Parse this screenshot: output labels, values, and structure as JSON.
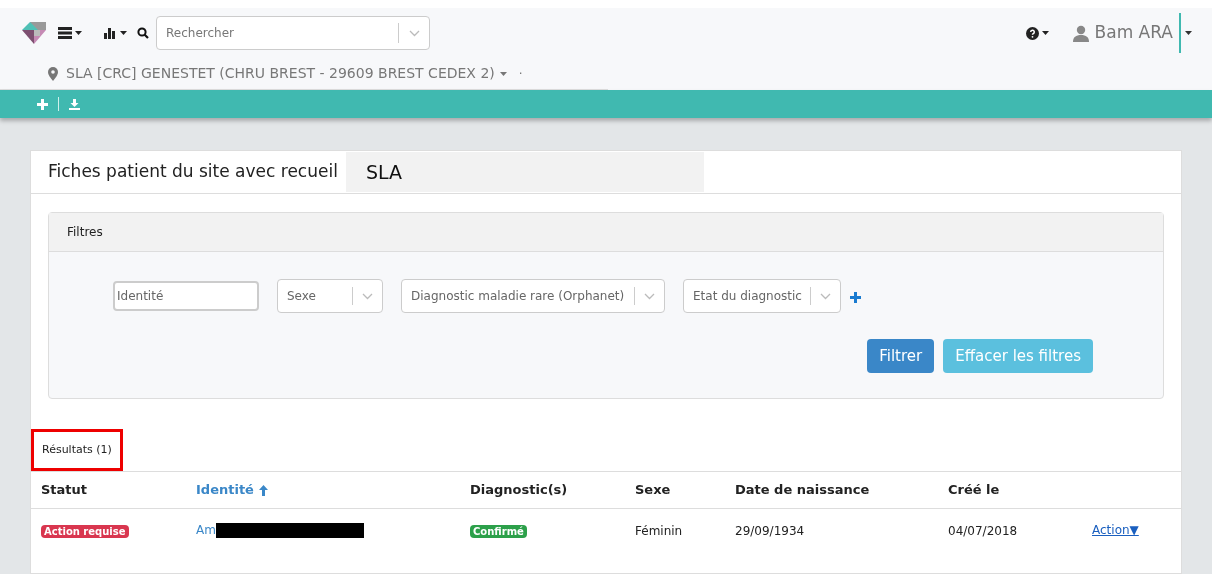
{
  "navbar": {
    "search": {
      "placeholder": "Rechercher"
    },
    "user": "Bam ARA",
    "site": "SLA [CRC] GENESTET (CHRU BREST - 29609 BREST CEDEX 2)",
    "site_extra": "·"
  },
  "card": {
    "title": "Fiches patient du site avec recueil",
    "selector": "SLA"
  },
  "filters": {
    "title": "Filtres",
    "identity": {
      "placeholder": "Identité"
    },
    "selects": [
      {
        "placeholder": "Sexe"
      },
      {
        "placeholder": "Diagnostic maladie rare (Orphanet)"
      },
      {
        "placeholder": "Etat du diagnostic"
      }
    ],
    "buttons": [
      {
        "label": "Filtrer",
        "kind": "primary"
      },
      {
        "label": "Effacer les filtres",
        "kind": "secondary"
      }
    ]
  },
  "results": {
    "label": "Résultats (1)",
    "highlighted": true
  },
  "table": {
    "columns": [
      {
        "label": "Statut",
        "sorted": false
      },
      {
        "label": "Identité",
        "sorted": true
      },
      {
        "label": "Diagnostic(s)",
        "sorted": false
      },
      {
        "label": "Sexe",
        "sorted": false
      },
      {
        "label": "Date de naissance",
        "sorted": false
      },
      {
        "label": "Créé le",
        "sorted": false
      }
    ],
    "rows": [
      {
        "status": "Action requise",
        "identity": "Am",
        "redacted": true,
        "diagnosis": "Confirmé",
        "sex": "Féminin",
        "birth": "29/09/1934",
        "created": "04/07/2018",
        "action": "Action▼"
      }
    ]
  }
}
